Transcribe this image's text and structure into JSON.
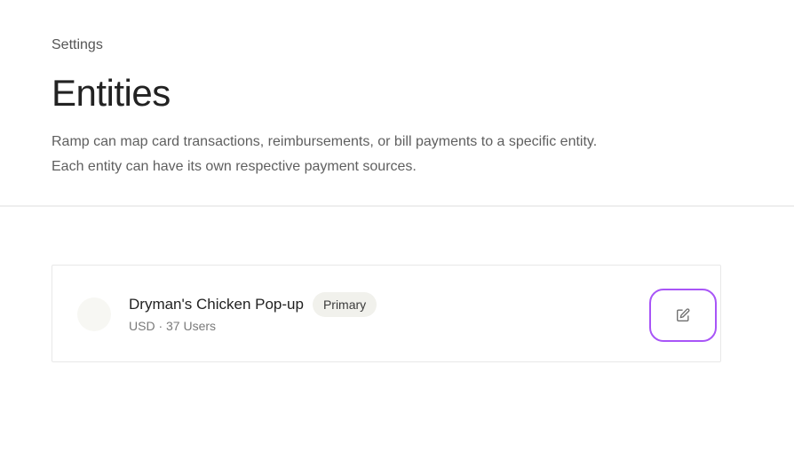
{
  "breadcrumb": "Settings",
  "page": {
    "title": "Entities",
    "description_line1": "Ramp can map card transactions, reimbursements, or bill payments to a specific entity.",
    "description_line2": "Each entity can have its own respective payment sources."
  },
  "entity": {
    "name": "Dryman's Chicken Pop-up",
    "badge": "Primary",
    "meta": "USD · 37 Users",
    "edit_icon": "edit-icon"
  },
  "colors": {
    "focus_ring": "#a855f7",
    "badge_bg": "#f1f1ec",
    "divider": "#eeeeee"
  }
}
